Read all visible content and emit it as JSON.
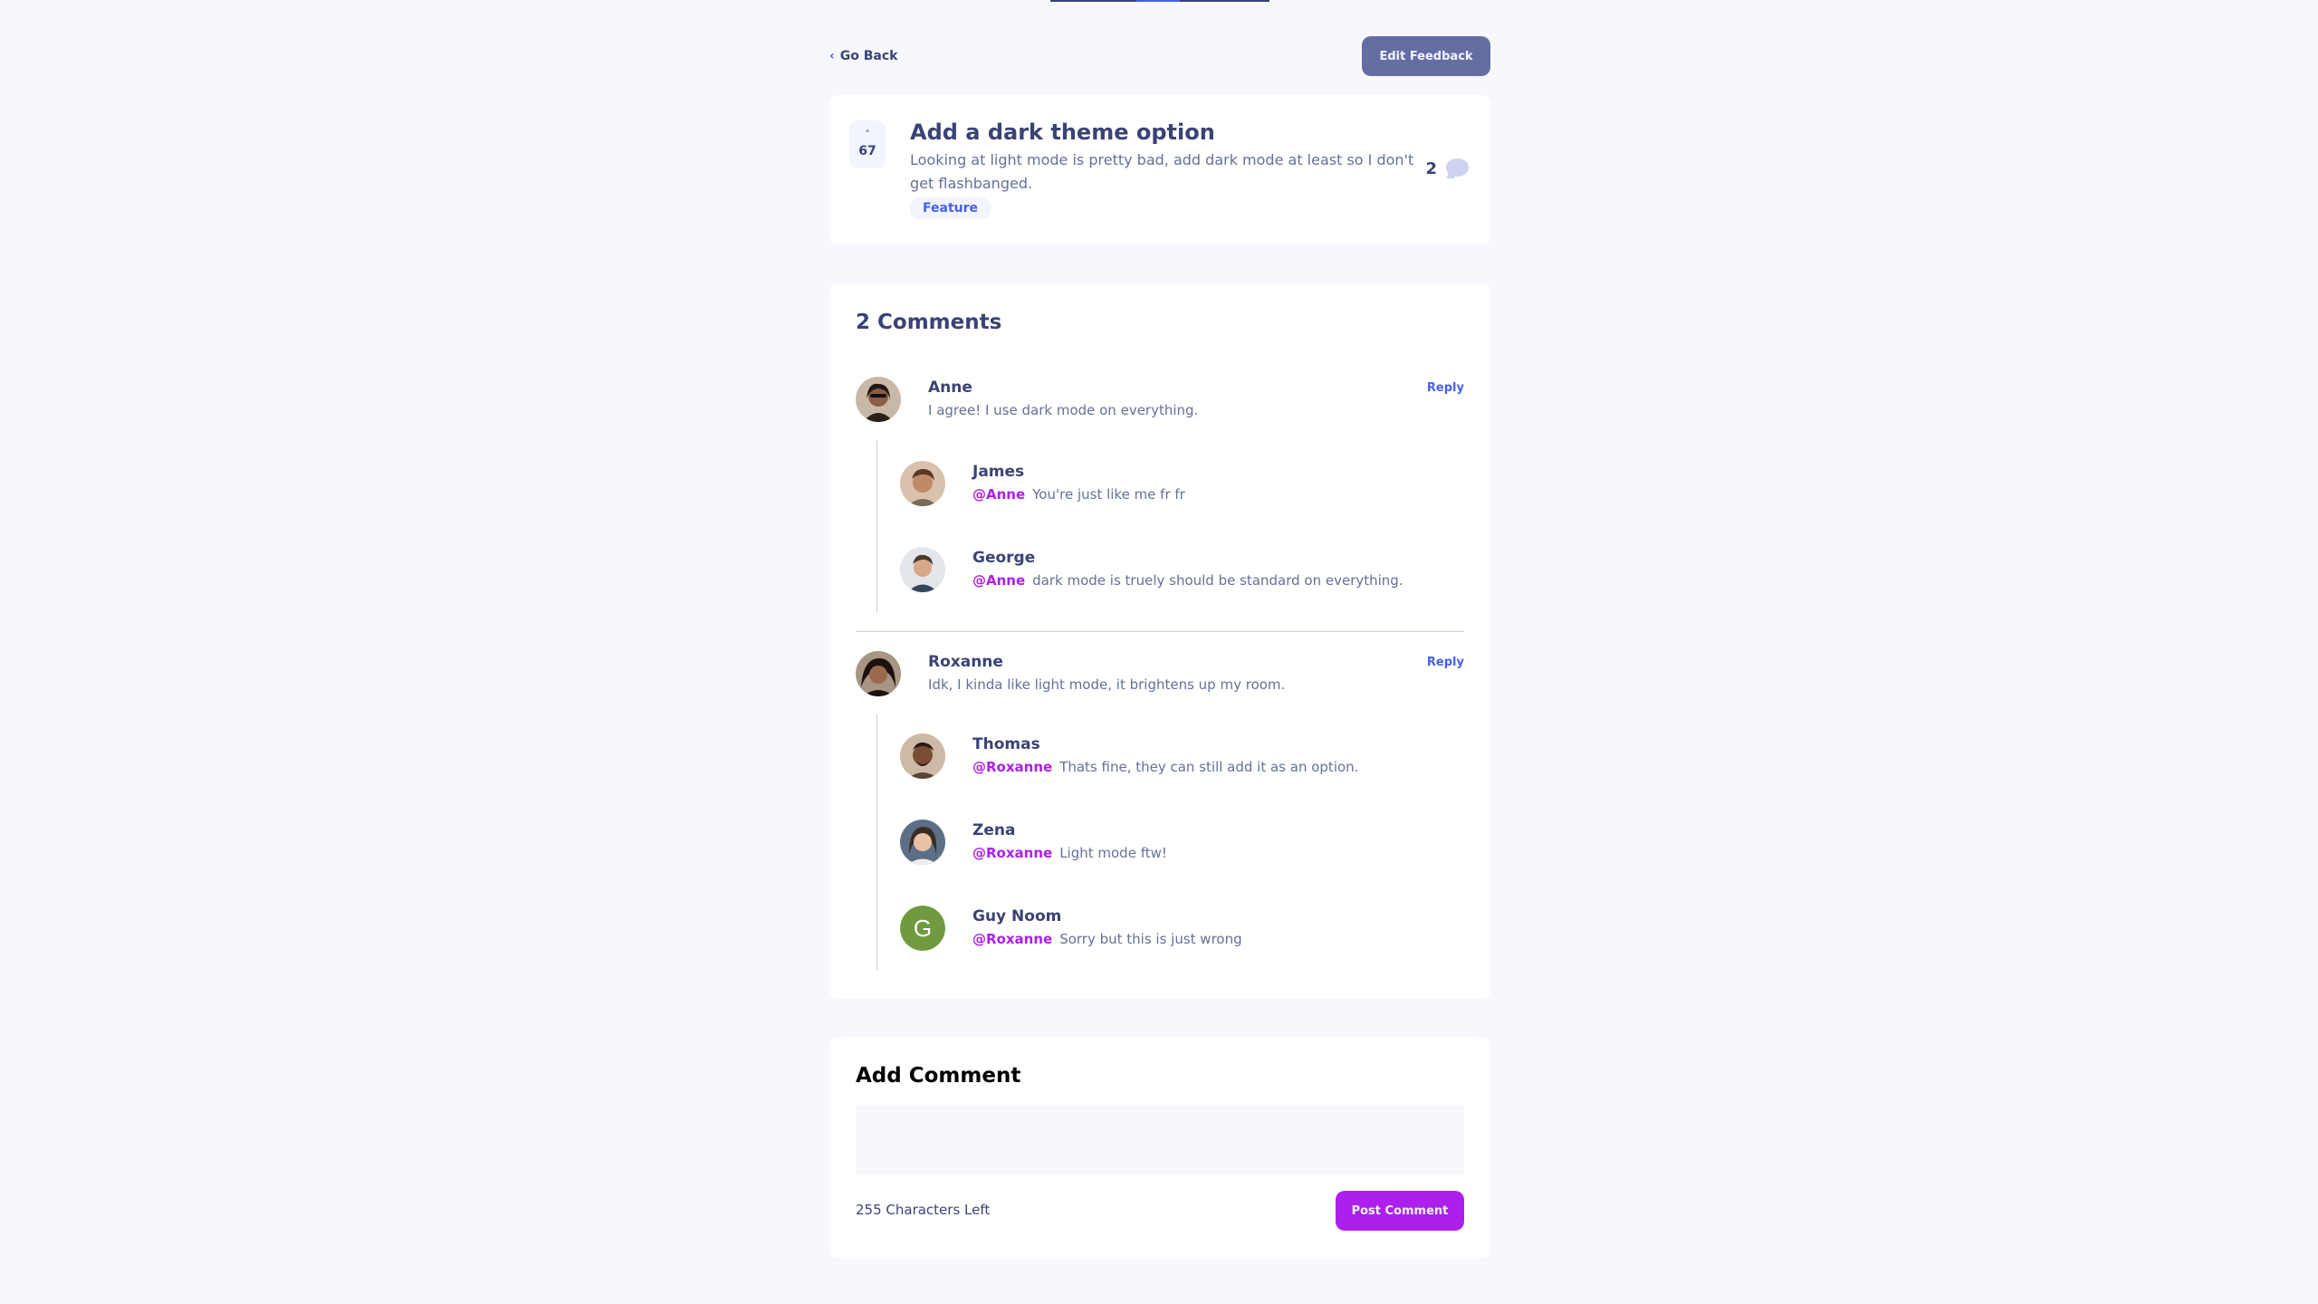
{
  "nav": {
    "go_back_label": "Go Back",
    "edit_label": "Edit Feedback"
  },
  "feedback": {
    "upvotes": "67",
    "title": "Add a dark theme option",
    "description": "Looking at light mode is pretty bad, add dark mode at least so I don't get flashbanged.",
    "tag": "Feature",
    "comment_count": "2"
  },
  "comments": {
    "heading": "2 Comments",
    "reply_label": "Reply",
    "threads": [
      {
        "name": "Anne",
        "text": "I agree! I use dark mode on everything.",
        "avatar_color": "#3b2b22",
        "replies": [
          {
            "name": "James",
            "mention": "@Anne",
            "text": "You're just like me fr fr",
            "avatar_color": "#8a5a3c"
          },
          {
            "name": "George",
            "mention": "@Anne",
            "text": "dark mode is truely should be standard on everything.",
            "avatar_color": "#2d3e52"
          }
        ]
      },
      {
        "name": "Roxanne",
        "text": "Idk, I kinda like light mode, it brightens up my room.",
        "avatar_color": "#2a1d18",
        "replies": [
          {
            "name": "Thomas",
            "mention": "@Roxanne",
            "text": "Thats fine, they can still add it as an option.",
            "avatar_color": "#6b4a34"
          },
          {
            "name": "Zena",
            "mention": "@Roxanne",
            "text": "Light mode ftw!",
            "avatar_color": "#4a5a70"
          },
          {
            "name": "Guy Noom",
            "mention": "@Roxanne",
            "text": "Sorry but this is just wrong",
            "avatar_letter": "G",
            "avatar_color": "#6f9a3f"
          }
        ]
      }
    ]
  },
  "add_comment": {
    "heading": "Add Comment",
    "placeholder": "",
    "chars_left": "255 Characters Left",
    "post_label": "Post Comment"
  },
  "colors": {
    "accent_purple": "#ad1fea",
    "accent_blue": "#4661e6",
    "dark_navy": "#3a4374",
    "edit_button": "#656ea3"
  }
}
